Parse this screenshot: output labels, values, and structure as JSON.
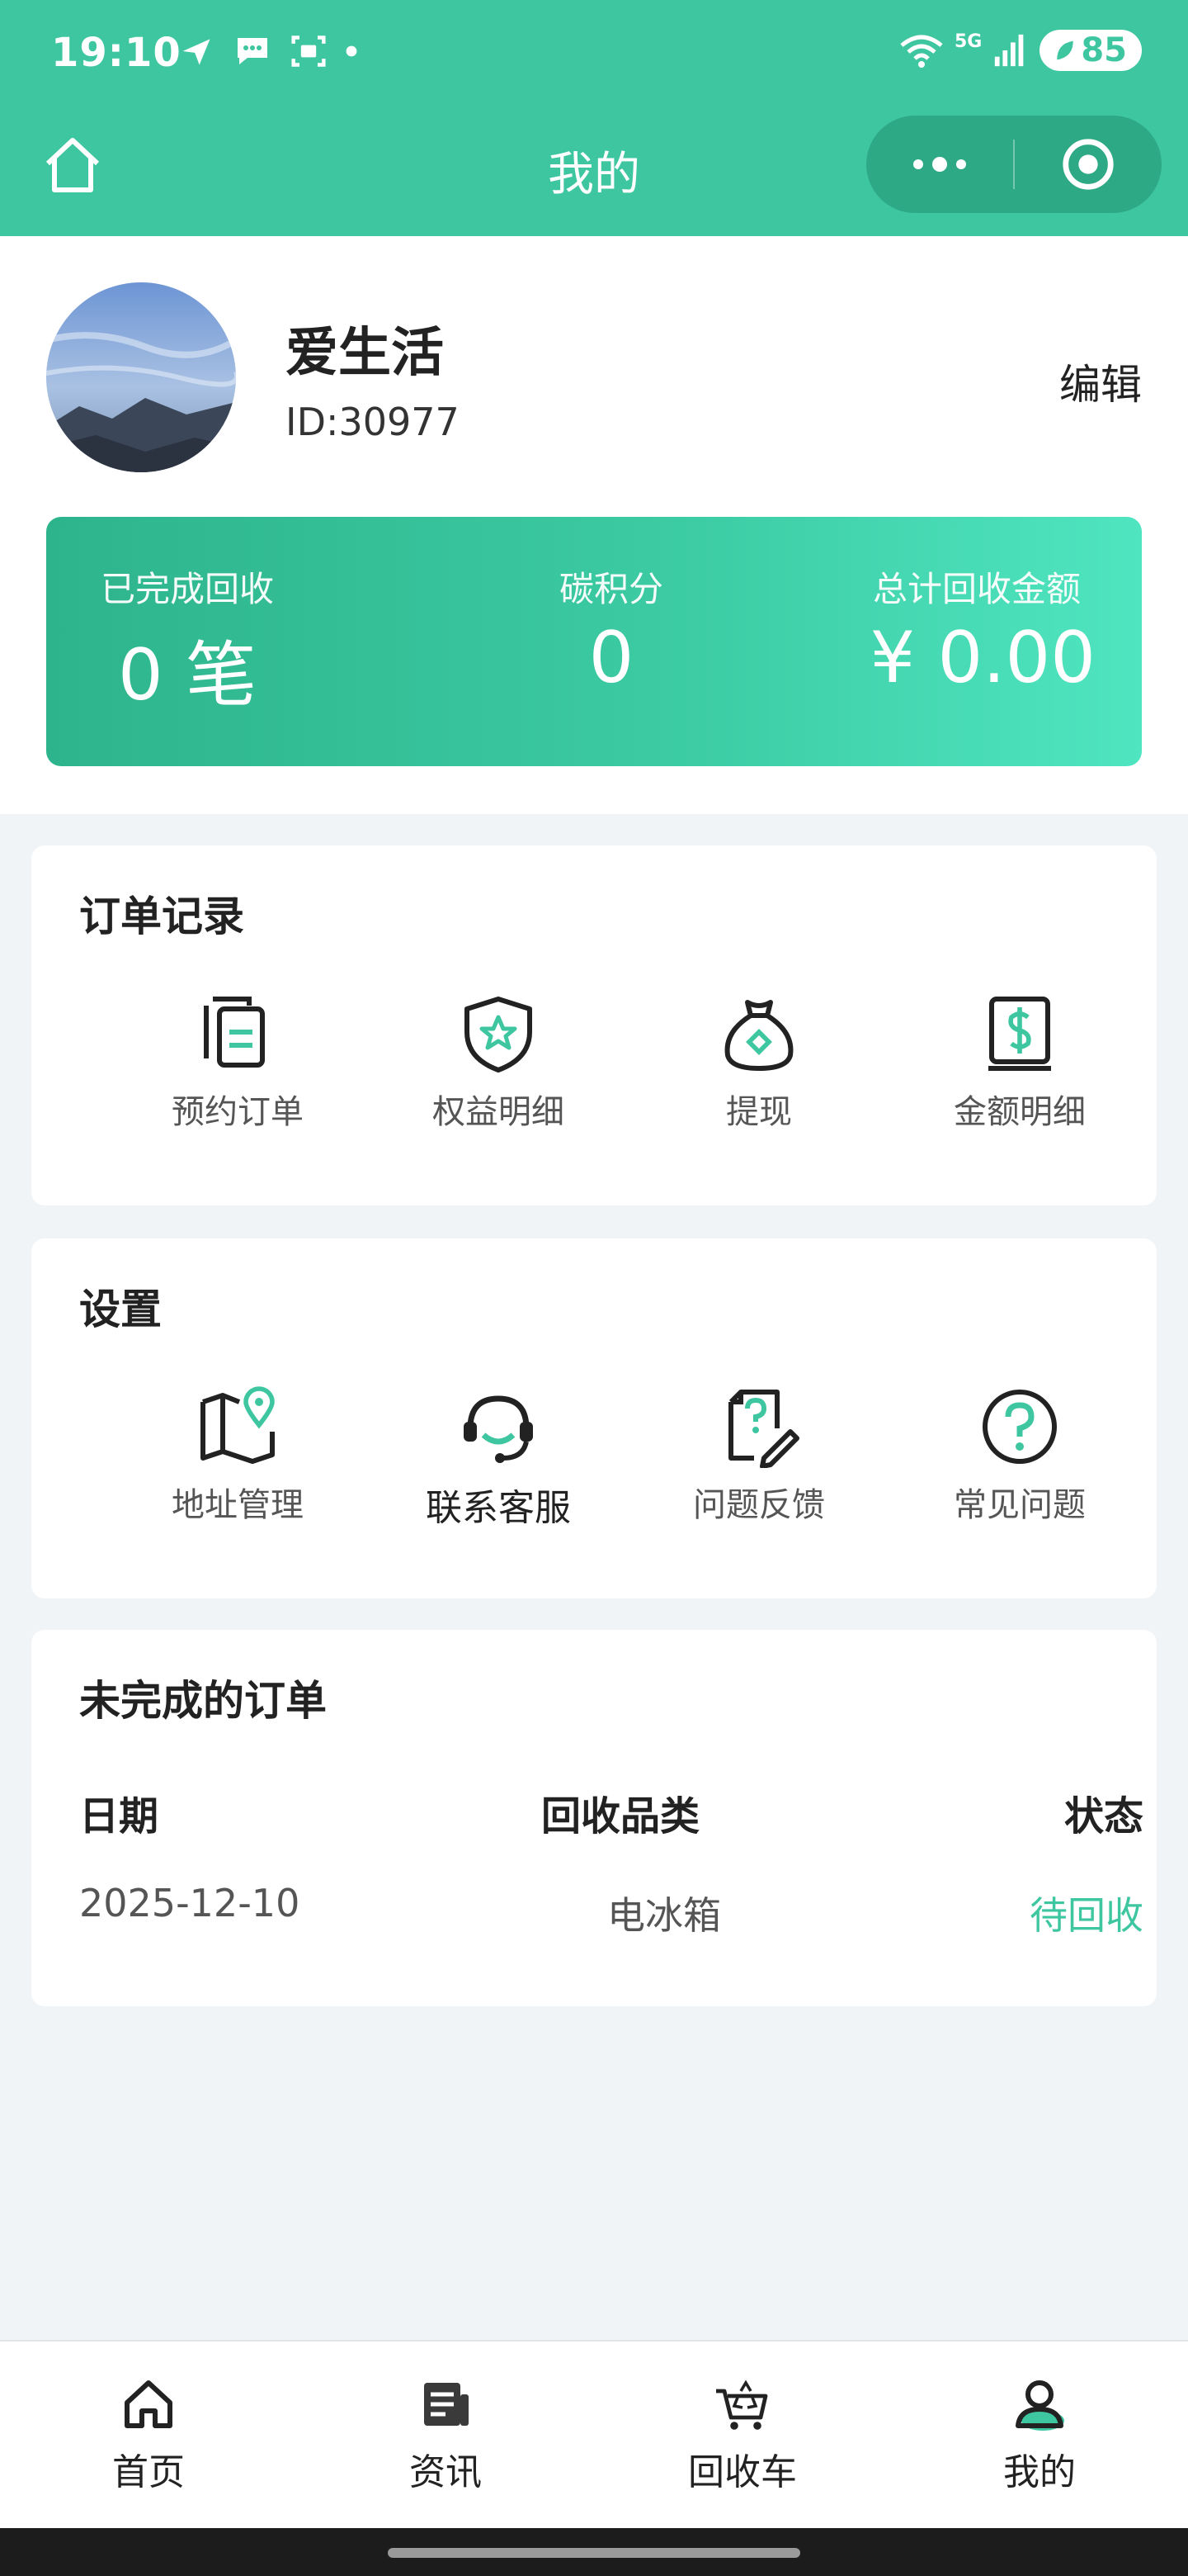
{
  "status_bar": {
    "time": "19:10",
    "battery": "85",
    "network": "5G"
  },
  "nav": {
    "title": "我的"
  },
  "profile": {
    "name": "爱生活",
    "id": "ID:30977",
    "edit_label": "编辑"
  },
  "stats": {
    "completed_label": "已完成回收",
    "completed_value": "0 笔",
    "carbon_label": "碳积分",
    "carbon_value": "0",
    "total_label": "总计回收金额",
    "total_value": "¥ 0.00"
  },
  "order_records": {
    "title": "订单记录",
    "items": [
      {
        "label": "预约订单",
        "icon": "documents-icon"
      },
      {
        "label": "权益明细",
        "icon": "shield-star-icon"
      },
      {
        "label": "提现",
        "icon": "money-bag-icon"
      },
      {
        "label": "金额明细",
        "icon": "dollar-receipt-icon"
      }
    ]
  },
  "settings": {
    "title": "设置",
    "items": [
      {
        "label": "地址管理",
        "icon": "map-pin-icon"
      },
      {
        "label": "联系客服",
        "icon": "headset-icon"
      },
      {
        "label": "问题反馈",
        "icon": "feedback-edit-icon"
      },
      {
        "label": "常见问题",
        "icon": "question-circle-icon"
      }
    ]
  },
  "unfinished_orders": {
    "title": "未完成的订单",
    "columns": [
      "日期",
      "回收品类",
      "状态"
    ],
    "rows": [
      {
        "date": "2025-12-10",
        "category": "电冰箱",
        "status": "待回收"
      }
    ]
  },
  "tabbar": {
    "items": [
      {
        "label": "首页",
        "icon": "home-icon"
      },
      {
        "label": "资讯",
        "icon": "news-icon"
      },
      {
        "label": "回收车",
        "icon": "recycle-cart-icon"
      },
      {
        "label": "我的",
        "icon": "user-icon"
      }
    ]
  },
  "colors": {
    "primary": "#3ec6a0",
    "capsule": "#2ea985",
    "background": "#f0f4f7"
  }
}
